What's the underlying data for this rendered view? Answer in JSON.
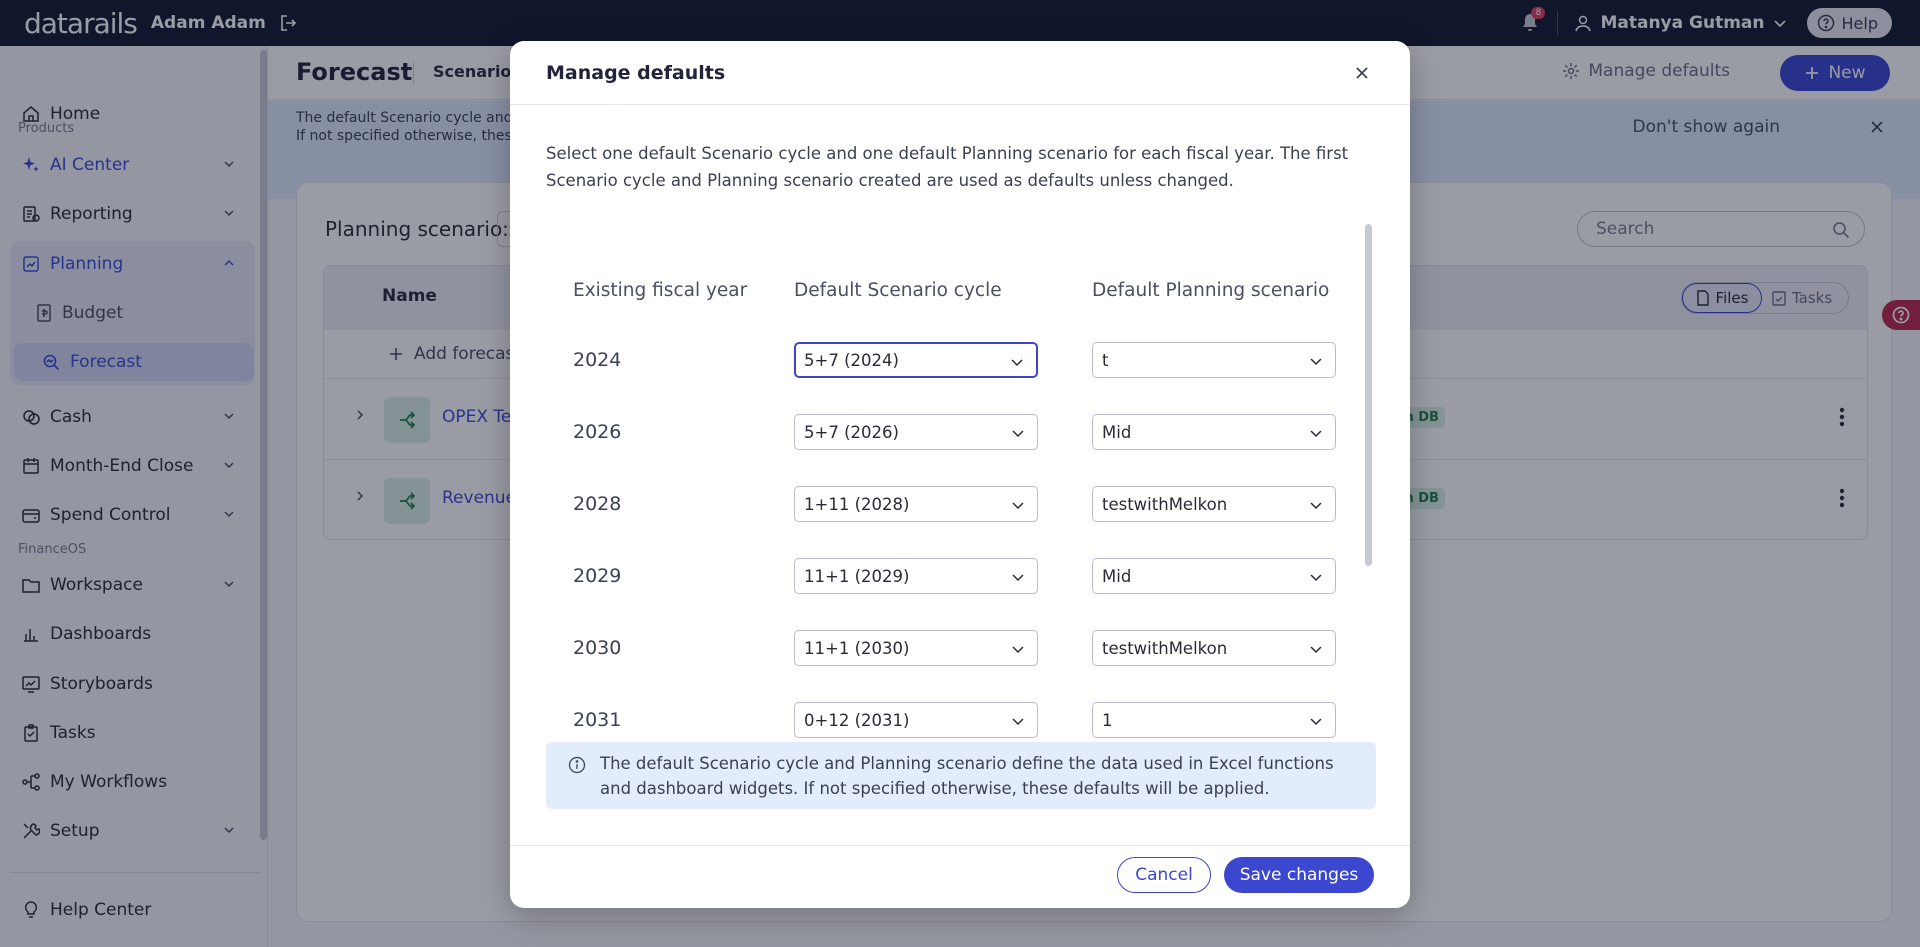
{
  "topbar": {
    "logo": "datarails",
    "user_short": "Adam Adam",
    "notifications_count": "8",
    "account_name": "Matanya Gutman",
    "help_label": "Help"
  },
  "sidebar": {
    "home": "Home",
    "products_section": "Products",
    "ai_center": "AI Center",
    "reporting": "Reporting",
    "planning": "Planning",
    "budget": "Budget",
    "forecast": "Forecast",
    "cash": "Cash",
    "month_end_close": "Month-End Close",
    "spend_control": "Spend Control",
    "financeos_section": "FinanceOS",
    "workspace": "Workspace",
    "dashboards": "Dashboards",
    "storyboards": "Storyboards",
    "tasks": "Tasks",
    "my_workflows": "My Workflows",
    "setup": "Setup",
    "help_center": "Help Center"
  },
  "header": {
    "title": "Forecast",
    "scenario_label": "Scenario c",
    "manage_defaults": "Manage defaults",
    "new_button": "New"
  },
  "banner": {
    "line1": "The default Scenario cycle and",
    "line2": "If not specified otherwise, these",
    "dont_show": "Don't show again"
  },
  "content": {
    "planning_scenario_label": "Planning scenario:",
    "search_placeholder": "Search",
    "name_column": "Name",
    "files_label": "Files",
    "tasks_label": "Tasks",
    "add_forecast": "Add forecas",
    "rows": [
      {
        "name": "OPEX Ter",
        "badge": "in DB"
      },
      {
        "name": "Revenue",
        "badge": "in DB"
      }
    ]
  },
  "modal": {
    "title": "Manage defaults",
    "description": "Select one default Scenario cycle and one default Planning scenario for each fiscal year. The first Scenario cycle and Planning scenario created are used as defaults unless changed.",
    "columns": {
      "year": "Existing fiscal year",
      "cycle": "Default Scenario cycle",
      "plan": "Default Planning scenario"
    },
    "rows": [
      {
        "year": "2024",
        "cycle": "5+7 (2024)",
        "plan": "t"
      },
      {
        "year": "2026",
        "cycle": "5+7 (2026)",
        "plan": "Mid"
      },
      {
        "year": "2028",
        "cycle": "1+11 (2028)",
        "plan": "testwithMelkon"
      },
      {
        "year": "2029",
        "cycle": "11+1 (2029)",
        "plan": "Mid"
      },
      {
        "year": "2030",
        "cycle": "11+1 (2030)",
        "plan": "testwithMelkon"
      },
      {
        "year": "2031",
        "cycle": "0+12 (2031)",
        "plan": "1"
      }
    ],
    "info": "The default Scenario cycle and Planning scenario define the data used in Excel functions and dashboard widgets. If not specified otherwise, these defaults will be applied.",
    "cancel": "Cancel",
    "save": "Save changes"
  },
  "colors": {
    "accent": "#3c47d0",
    "topbar": "#121a2f",
    "info_bg": "#e3ecfb"
  }
}
